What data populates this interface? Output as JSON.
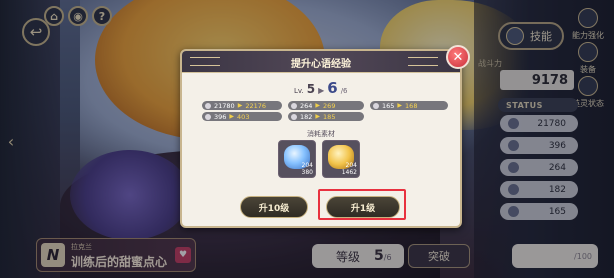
{
  "top_buttons": {
    "home": "⌂",
    "help": "?"
  },
  "nav": {
    "back": "↩",
    "prev": "‹",
    "next": "›"
  },
  "right_panel": {
    "skill_label": "技能",
    "menu": [
      {
        "label": "能力强化"
      },
      {
        "label": "装备"
      },
      {
        "label": "英灵状态"
      }
    ],
    "power_label": "战斗力",
    "power_value": "9178",
    "status_label": "STATUS",
    "stats": [
      "21780",
      "396",
      "264",
      "182",
      "165"
    ]
  },
  "modal": {
    "title": "提升心语经验",
    "close": "✕",
    "level": {
      "prefix": "Lv.",
      "from": "5",
      "arrow": "▶",
      "to": "6",
      "max": "/6"
    },
    "stat_changes": [
      [
        {
          "old": "21780",
          "new": "22176"
        },
        {
          "old": "264",
          "new": "269"
        },
        {
          "old": "165",
          "new": "168"
        }
      ],
      [
        {
          "old": "396",
          "new": "403"
        },
        {
          "old": "182",
          "new": "185"
        }
      ]
    ],
    "arrow": "▶",
    "materials_label": "消耗素材",
    "materials": [
      {
        "owned": "204",
        "need": "380"
      },
      {
        "owned": "204",
        "need": "1462"
      }
    ],
    "btn_ten": "升10级",
    "btn_one": "升1级"
  },
  "bottom": {
    "name_logo": "N",
    "name_sub": "拉克兰",
    "name_title": "训练后的甜蜜点心",
    "level_label": "等级",
    "level_value": "5",
    "level_max": "/6",
    "break_label": "突破",
    "limit_text": "/100"
  }
}
